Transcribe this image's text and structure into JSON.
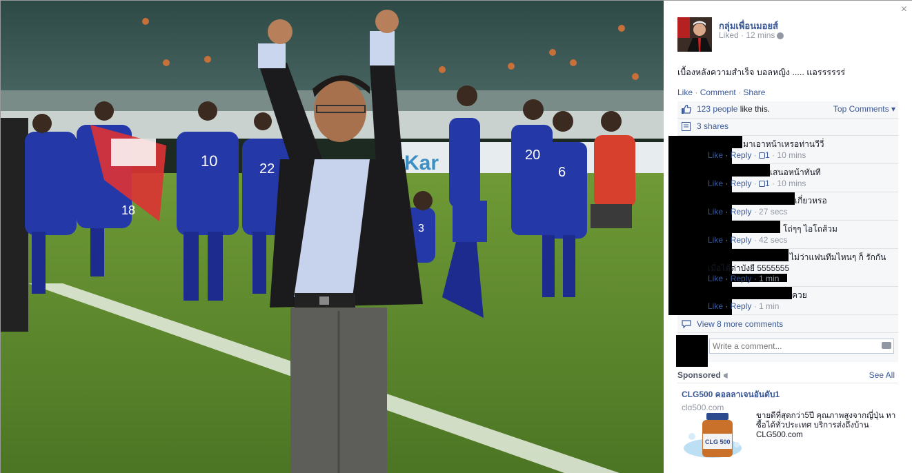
{
  "panel": {
    "author": "กลุ่มเพื่อนมอยส์",
    "meta": "Liked · 12 mins",
    "post_text": "เบื้องหลังความสำเร็จ บอลหญิง ..... แอรรรรรร่",
    "actions": {
      "like": "Like",
      "comment": "Comment",
      "share": "Share"
    },
    "likes_count": "123 people",
    "likes_suffix": " like this.",
    "top_comments": "Top Comments",
    "shares": "3 shares",
    "comments": [
      {
        "text": "มาเอาหน้าเหรอท่านวีวี่",
        "like": "Like",
        "reply": "Reply",
        "likes": "1",
        "time": "10 mins"
      },
      {
        "text": "เสนอหน้าทันที",
        "like": "Like",
        "reply": "Reply",
        "likes": "1",
        "time": "10 mins"
      },
      {
        "text": "เกี่ยวหรอ",
        "like": "Like",
        "reply": "Reply",
        "time": "27 secs"
      },
      {
        "text": "โถ่ๆๆ ไอโถส้วม",
        "like": "Like",
        "reply": "Reply",
        "time": "42 secs"
      },
      {
        "text": "ไม่ว่าแฟนทีมไหนๆ ก็ รักกัน",
        "text2": "เมื่อได้ด่าบังยี 5555555",
        "like": "Like",
        "reply": "Reply",
        "time": "1 min"
      },
      {
        "text": "ควย",
        "like": "Like",
        "reply": "Reply",
        "time": "1 min"
      }
    ],
    "view_more": "View 8 more comments",
    "write_placeholder": "Write a comment...",
    "sponsored": "Sponsored",
    "see_all": "See All",
    "ad": {
      "title": "CLG500 คอลลาเจนอันดับ1",
      "domain": "clg500.com",
      "body": "ขายดีที่สุดกว่า5ปี คุณภาพสูงจากญี่ปุ่น หาซื้อได้ทั่วประเทศ บริการส่งถึงบ้าน CLG500.com",
      "bottle_label": "CLG 500"
    },
    "close": "×"
  },
  "photo": {
    "shirt_numbers": [
      "20",
      "10",
      "22",
      "6",
      "18",
      "3"
    ],
    "banner_text": "Kar"
  },
  "colors": {
    "link": "#3b5998",
    "grass": "#5e8a2e",
    "jersey": "#2438a8"
  }
}
